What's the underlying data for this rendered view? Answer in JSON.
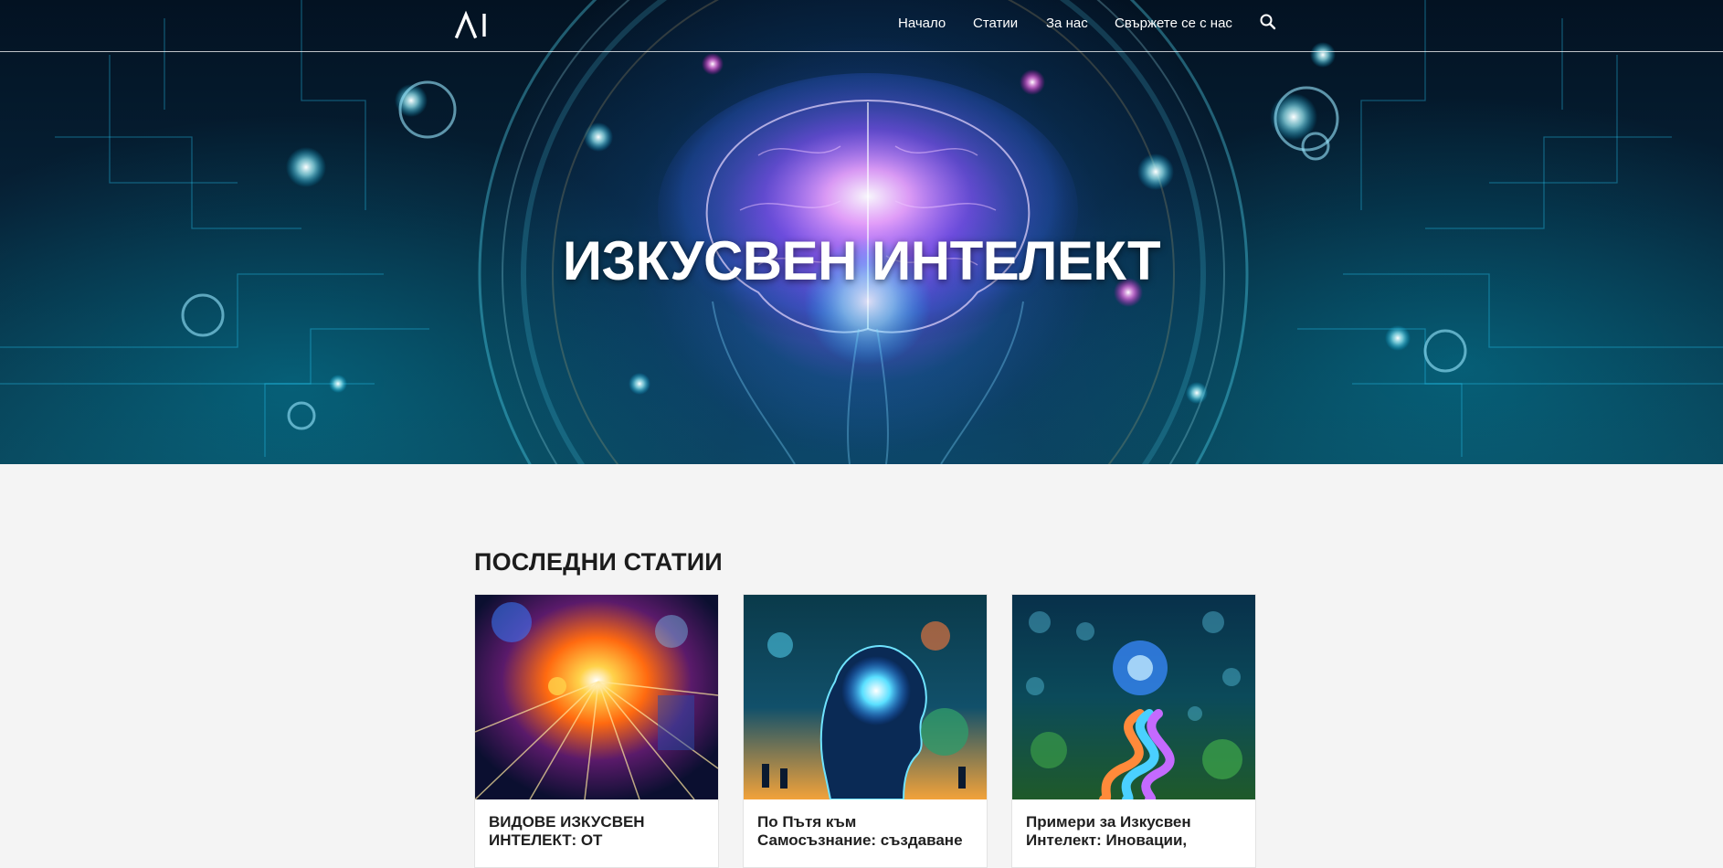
{
  "header": {
    "logo_text": "AI",
    "nav": [
      {
        "label": "Начало"
      },
      {
        "label": "Статии"
      },
      {
        "label": "За нас"
      },
      {
        "label": "Свържете се с нас"
      }
    ],
    "search_icon": "search-icon"
  },
  "hero": {
    "title": "ИЗКУСВЕН ИНТЕЛЕКТ"
  },
  "latest": {
    "heading": "ПОСЛЕДНИ СТАТИИ",
    "articles": [
      {
        "title": "ВИДОВЕ ИЗКУСВЕН ИНТЕЛЕКТ: ОТ"
      },
      {
        "title": "По Пътя към Самосъзнание: създаване"
      },
      {
        "title": "Примери за Изкусвен Интелект: Иновации,"
      }
    ]
  },
  "colors": {
    "page_background": "#f4f4f4",
    "heading_text": "#1c1c1c",
    "hero_text": "#ffffff",
    "hero_base": "#062136",
    "accent_cyan": "#36d1ff",
    "accent_magenta": "#e060ff"
  }
}
